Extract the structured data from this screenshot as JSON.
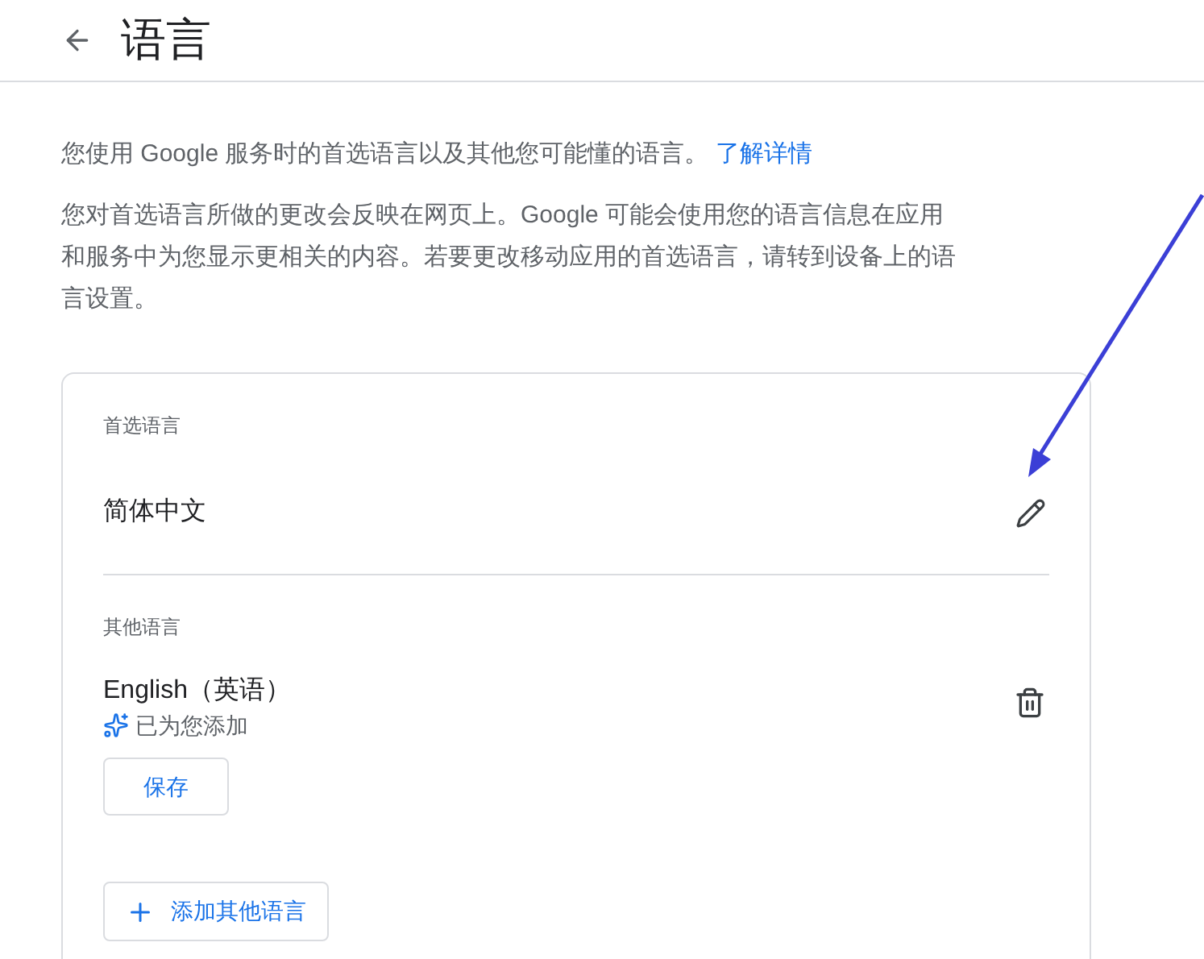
{
  "header": {
    "title": "语言"
  },
  "intro": {
    "text": "您使用 Google 服务时的首选语言以及其他您可能懂的语言。",
    "link": "了解详情"
  },
  "notice": "您对首选语言所做的更改会反映在网页上。Google 可能会使用您的语言信息在应用和服务中为您显示更相关的内容。若要更改移动应用的首选语言，请转到设备上的语言设置。",
  "preferred": {
    "heading": "首选语言",
    "language": "简体中文"
  },
  "other": {
    "heading": "其他语言",
    "languages": [
      {
        "name": "English（英语）",
        "note": "已为您添加",
        "button": "保存"
      }
    ]
  },
  "add_button": "添加其他语言"
}
